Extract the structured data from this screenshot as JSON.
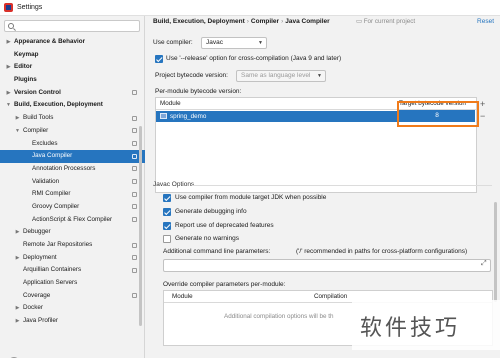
{
  "window": {
    "title": "Settings"
  },
  "sidebar": {
    "items": [
      {
        "label": "Appearance & Behavior",
        "arrow": "▶",
        "bold": true,
        "indent": 0,
        "icon": false
      },
      {
        "label": "Keymap",
        "arrow": "",
        "bold": true,
        "indent": 0,
        "icon": false
      },
      {
        "label": "Editor",
        "arrow": "▶",
        "bold": true,
        "indent": 0,
        "icon": false
      },
      {
        "label": "Plugins",
        "arrow": "",
        "bold": true,
        "indent": 0,
        "icon": false
      },
      {
        "label": "Version Control",
        "arrow": "▶",
        "bold": true,
        "indent": 0,
        "icon": true
      },
      {
        "label": "Build, Execution, Deployment",
        "arrow": "▼",
        "bold": true,
        "indent": 0,
        "icon": false
      },
      {
        "label": "Build Tools",
        "arrow": "▶",
        "bold": false,
        "indent": 1,
        "icon": true
      },
      {
        "label": "Compiler",
        "arrow": "▼",
        "bold": false,
        "indent": 1,
        "icon": true
      },
      {
        "label": "Excludes",
        "arrow": "",
        "bold": false,
        "indent": 2,
        "icon": true
      },
      {
        "label": "Java Compiler",
        "arrow": "",
        "bold": false,
        "indent": 2,
        "icon": true,
        "selected": true
      },
      {
        "label": "Annotation Processors",
        "arrow": "",
        "bold": false,
        "indent": 2,
        "icon": true
      },
      {
        "label": "Validation",
        "arrow": "",
        "bold": false,
        "indent": 2,
        "icon": true
      },
      {
        "label": "RMI Compiler",
        "arrow": "",
        "bold": false,
        "indent": 2,
        "icon": true
      },
      {
        "label": "Groovy Compiler",
        "arrow": "",
        "bold": false,
        "indent": 2,
        "icon": true
      },
      {
        "label": "ActionScript & Flex Compiler",
        "arrow": "",
        "bold": false,
        "indent": 2,
        "icon": true
      },
      {
        "label": "Debugger",
        "arrow": "▶",
        "bold": false,
        "indent": 1,
        "icon": false
      },
      {
        "label": "Remote Jar Repositories",
        "arrow": "",
        "bold": false,
        "indent": 1,
        "icon": true
      },
      {
        "label": "Deployment",
        "arrow": "▶",
        "bold": false,
        "indent": 1,
        "icon": true
      },
      {
        "label": "Arquillian Containers",
        "arrow": "",
        "bold": false,
        "indent": 1,
        "icon": true
      },
      {
        "label": "Application Servers",
        "arrow": "",
        "bold": false,
        "indent": 1,
        "icon": false
      },
      {
        "label": "Coverage",
        "arrow": "",
        "bold": false,
        "indent": 1,
        "icon": true
      },
      {
        "label": "Docker",
        "arrow": "▶",
        "bold": false,
        "indent": 1,
        "icon": false
      },
      {
        "label": "Java Profiler",
        "arrow": "▶",
        "bold": false,
        "indent": 1,
        "icon": false
      }
    ]
  },
  "header": {
    "breadcrumb": [
      "Build, Execution, Deployment",
      "Compiler",
      "Java Compiler"
    ],
    "for_current_project": "For current project",
    "reset": "Reset"
  },
  "compiler": {
    "use_compiler_label": "Use compiler:",
    "use_compiler_value": "Javac",
    "release_option": "Use '--release' option for cross-compilation (Java 9 and later)",
    "project_bytecode_label": "Project bytecode version:",
    "project_bytecode_value": "Same as language level",
    "per_module_label": "Per-module bytecode version:",
    "table": {
      "col_module": "Module",
      "col_target": "Target bytecode version",
      "rows": [
        {
          "module": "spring_demo",
          "target": "8"
        }
      ]
    }
  },
  "javac": {
    "section_title": "Javac Options",
    "options": [
      {
        "label": "Use compiler from module target JDK when possible",
        "checked": true
      },
      {
        "label": "Generate debugging info",
        "checked": true
      },
      {
        "label": "Report use of deprecated features",
        "checked": true
      },
      {
        "label": "Generate no warnings",
        "checked": false
      }
    ],
    "additional_label": "Additional command line parameters:",
    "additional_hint": "('/' recommended in paths for cross-platform configurations)",
    "override_label": "Override compiler parameters per-module:",
    "override_cols": [
      "Module",
      "Compilation"
    ],
    "override_placeholder": "Additional compilation options will be th"
  },
  "help": "?",
  "watermark": "软件技巧",
  "colors": {
    "selection": "#2675bf",
    "highlight": "#f07b1a"
  }
}
